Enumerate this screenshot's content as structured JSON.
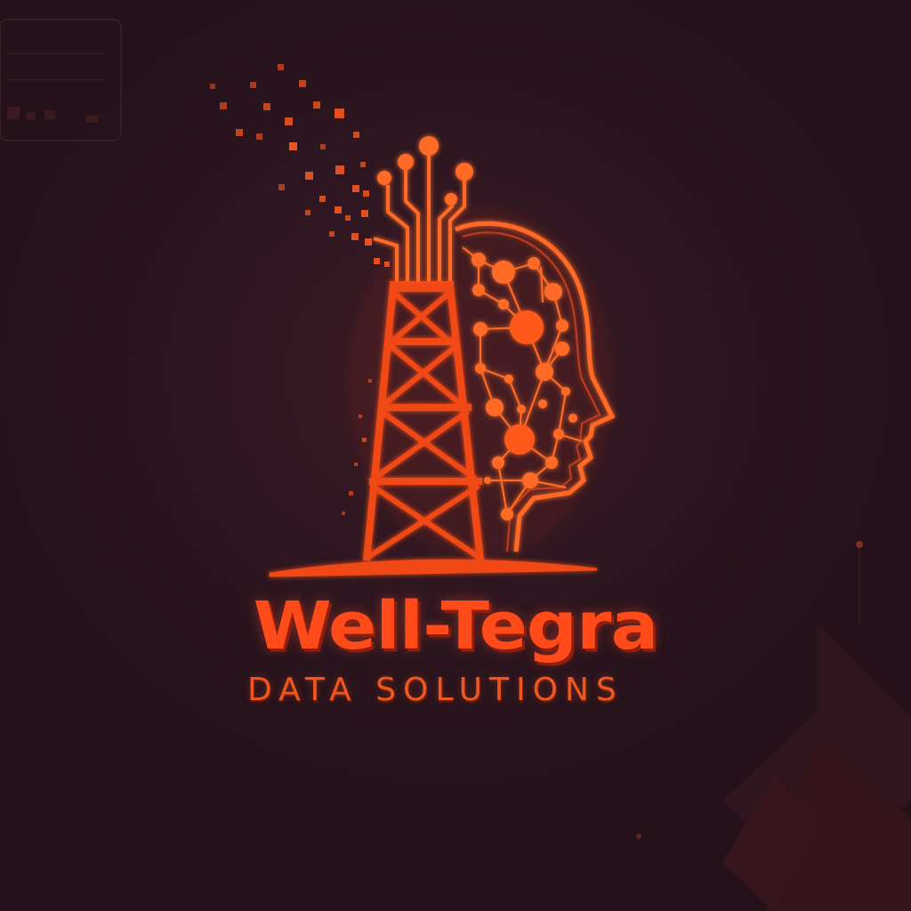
{
  "logo": {
    "title": "Well-Tegra",
    "subtitle": "DATA SOLUTIONS"
  },
  "colors": {
    "background": "#2a1520",
    "primary": "#ff4a1a",
    "accent_glow": "#ff7a2e",
    "shadow": "#8e1f0e"
  },
  "icons": [
    "oil-derrick-icon",
    "circuit-head-icon",
    "data-pixels-icon"
  ]
}
